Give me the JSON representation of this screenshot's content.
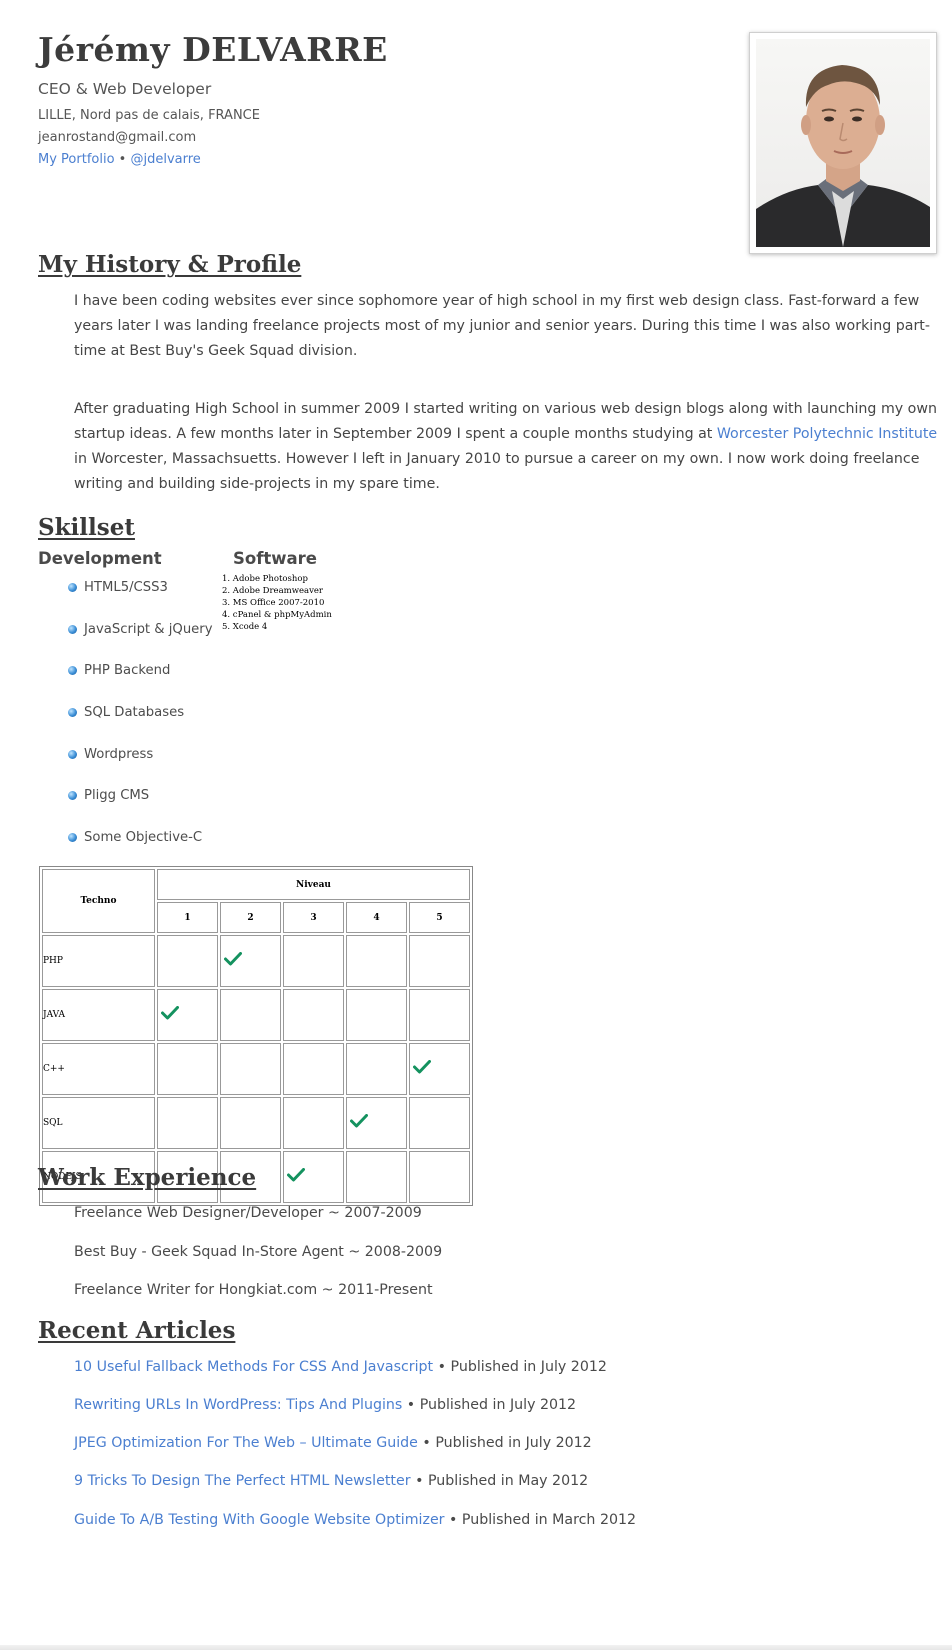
{
  "header": {
    "name": "Jérémy DELVARRE",
    "role": "CEO & Web Developer",
    "location": "LILLE, Nord pas de calais, FRANCE",
    "email": "jeanrostand@gmail.com",
    "portfolio_link": "My Portfolio",
    "separator": "•",
    "twitter_link": "@jdelvarre"
  },
  "profile": {
    "heading": "My History & Profile",
    "paragraph1": "I have been coding websites ever since sophomore year of high school in my first web design class. Fast-forward a few years later I was landing freelance projects most of my junior and senior years. During this time I was also working part-time at Best Buy's Geek Squad division.",
    "paragraph2_before": "After graduating High School in summer 2009 I started writing on various web design blogs along with launching my own startup ideas. A few months later in September 2009 I spent a couple months studying at ",
    "paragraph2_link": "Worcester Polytechnic Institute",
    "paragraph2_after": " in Worcester, Massachsuetts. However I left in January 2010 to pursue a career on my own. I now work doing freelance writing and building side-projects in my spare time."
  },
  "skillset": {
    "heading": "Skillset",
    "development_heading": "Development",
    "development": [
      "HTML5/CSS3",
      "JavaScript & jQuery",
      "PHP Backend",
      "SQL Databases",
      "Wordpress",
      "Pligg CMS",
      "Some Objective-C"
    ],
    "software_heading": "Software",
    "software": [
      "1. Adobe Photoshop",
      "2. Adobe Dreamweaver",
      "3. MS Office 2007-2010",
      "4. cPanel & phpMyAdmin",
      "5. Xcode 4"
    ]
  },
  "skills_table": {
    "techno_header": "Techno",
    "niveau_header": "Niveau",
    "levels": [
      "1",
      "2",
      "3",
      "4",
      "5"
    ],
    "rows": [
      {
        "techno": "PHP",
        "level": 2
      },
      {
        "techno": "JAVA",
        "level": 1
      },
      {
        "techno": "C++",
        "level": 5
      },
      {
        "techno": "SQL",
        "level": 4
      },
      {
        "techno": "NODEJS",
        "level": 3
      }
    ],
    "check_icon": "checkmark-icon",
    "check_color": "#14925f"
  },
  "work": {
    "heading": "Work Experience",
    "items": [
      "Freelance Web Designer/Developer ~ 2007-2009",
      "Best Buy - Geek Squad In-Store Agent ~ 2008-2009",
      "Freelance Writer for Hongkiat.com ~ 2011-Present"
    ]
  },
  "articles": {
    "heading": "Recent Articles",
    "separator": "•",
    "items": [
      {
        "title": "10 Useful Fallback Methods For CSS And Javascript",
        "published": "Published in July 2012"
      },
      {
        "title": "Rewriting URLs In WordPress: Tips And Plugins",
        "published": "Published in July 2012"
      },
      {
        "title": "JPEG Optimization For The Web – Ultimate Guide",
        "published": "Published in July 2012"
      },
      {
        "title": "9 Tricks To Design The Perfect HTML Newsletter",
        "published": "Published in May 2012"
      },
      {
        "title": "Guide To A/B Testing With Google Website Optimizer",
        "published": "Published in March 2012"
      }
    ]
  },
  "colors": {
    "link": "#4b7fd0",
    "text": "#454545",
    "bullet": "#3a8ed6"
  }
}
